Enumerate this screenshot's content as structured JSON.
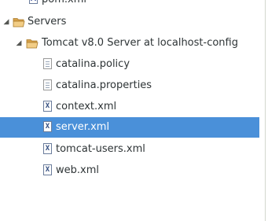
{
  "tree": {
    "top_item": {
      "label": "pom.xml",
      "icon": "maven-pom-icon"
    },
    "servers": {
      "label": "Servers",
      "expanded": true,
      "icon": "folder-open-icon",
      "server": {
        "label": "Tomcat v8.0 Server at localhost-config",
        "expanded": true,
        "icon": "folder-open-icon",
        "files": [
          {
            "label": "catalina.policy",
            "icon": "text-file-icon",
            "selected": false
          },
          {
            "label": "catalina.properties",
            "icon": "text-file-icon",
            "selected": false
          },
          {
            "label": "context.xml",
            "icon": "xml-file-icon",
            "selected": false
          },
          {
            "label": "server.xml",
            "icon": "xml-file-icon",
            "selected": true
          },
          {
            "label": "tomcat-users.xml",
            "icon": "xml-file-icon",
            "selected": false
          },
          {
            "label": "web.xml",
            "icon": "xml-file-icon",
            "selected": false
          }
        ]
      }
    }
  },
  "colors": {
    "selection": "#4a90d9",
    "folder": "#e9b96e",
    "text": "#2e3436"
  }
}
